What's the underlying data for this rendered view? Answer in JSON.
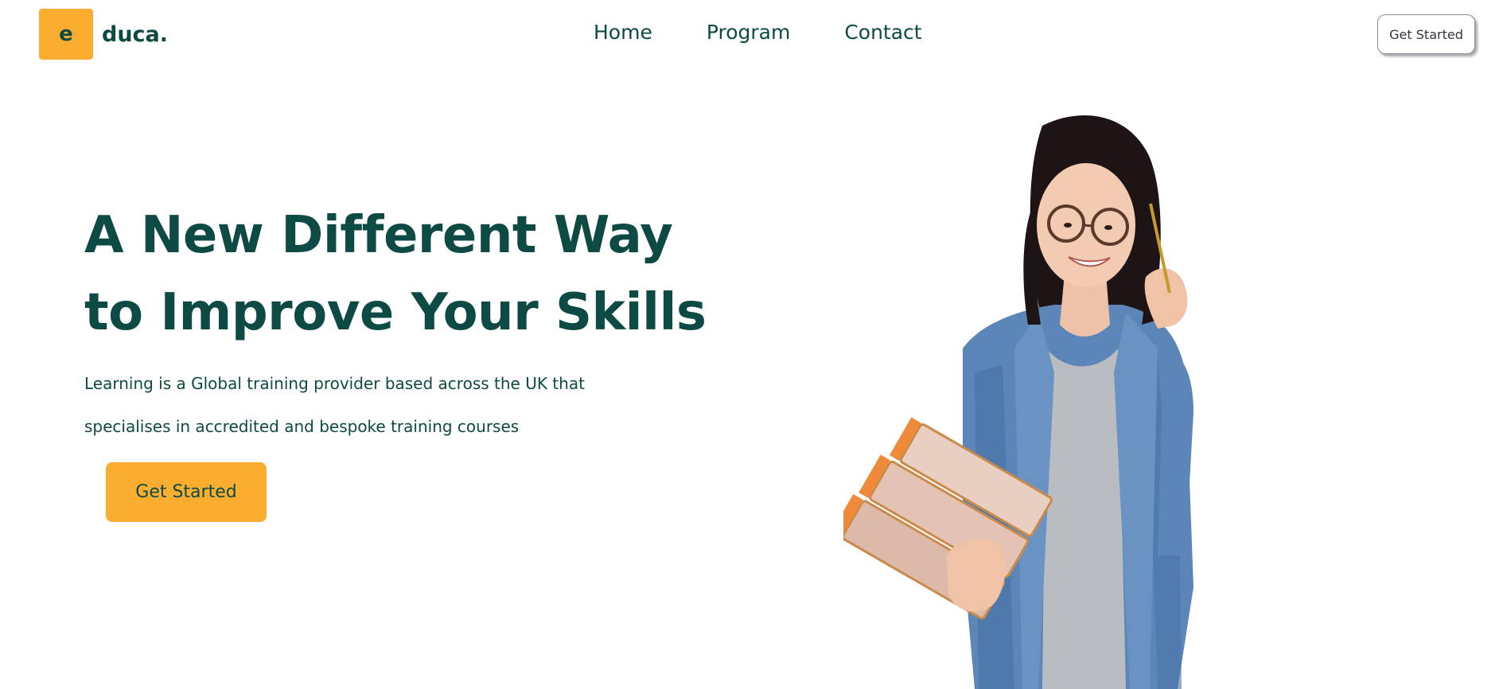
{
  "brand": {
    "badge_letter": "e",
    "name": "duca.",
    "accent_color": "#FBAD30",
    "primary_color": "#0C4A43"
  },
  "nav": {
    "items": [
      {
        "label": "Home"
      },
      {
        "label": "Program"
      },
      {
        "label": "Contact"
      }
    ],
    "cta_label": "Get Started"
  },
  "hero": {
    "title_lines": [
      "A New Different Way",
      "to Improve Your Skills"
    ],
    "description_lines": [
      "Learning is a Global training provider based across the UK that",
      "specialises in accredited and bespoke training courses"
    ],
    "cta_label": "Get Started",
    "image_icon": "student-with-books-illustration"
  }
}
